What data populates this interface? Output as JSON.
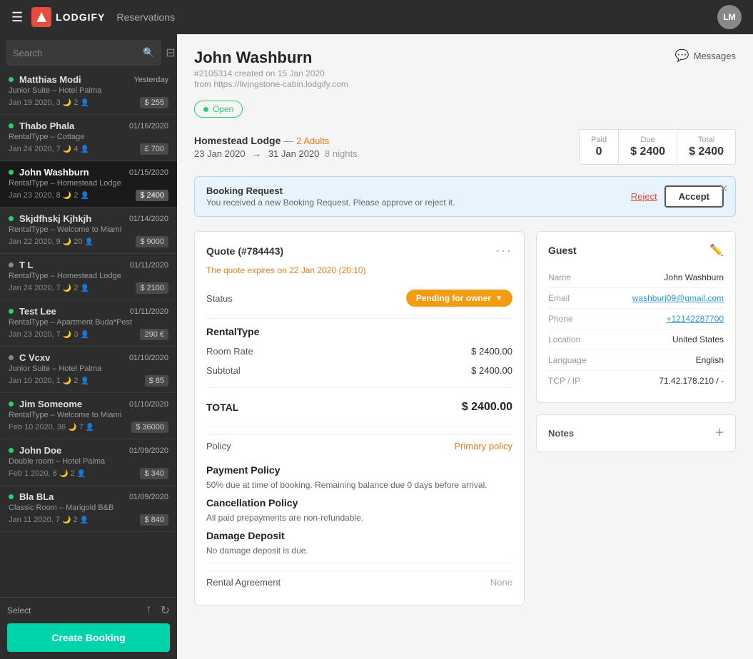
{
  "nav": {
    "brand": "LODGIFY",
    "page_title": "Reservations",
    "avatar_initials": "LM"
  },
  "sidebar": {
    "search_placeholder": "Search",
    "filter_icon": "⊟",
    "items": [
      {
        "name": "Matthias Modi",
        "date": "Yesterday",
        "subtitle": "Junior Suite – Hotel Palma",
        "dates_guests": "Jan 19 2020, 3 · 2",
        "amount": "$ 255",
        "active": false,
        "dot_color": "green"
      },
      {
        "name": "Thabo Phala",
        "date": "01/16/2020",
        "subtitle": "RentalType – Cottage",
        "dates_guests": "Jan 24 2020, 7 · 4",
        "amount": "£ 700",
        "active": false,
        "dot_color": "green"
      },
      {
        "name": "John Washburn",
        "date": "01/15/2020",
        "subtitle": "RentalType – Homestead Lodge",
        "dates_guests": "Jan 23 2020, 8 · 2",
        "amount": "$ 2400",
        "active": true,
        "dot_color": "green"
      },
      {
        "name": "Skjdfhskj Kjhkjh",
        "date": "01/14/2020",
        "subtitle": "RentalType – Welcome to Miami",
        "dates_guests": "Jan 22 2020, 9 · 20",
        "amount": "$ 9000",
        "active": false,
        "dot_color": "green"
      },
      {
        "name": "T L",
        "date": "01/11/2020",
        "subtitle": "RentalType – Homestead Lodge",
        "dates_guests": "Jan 24 2020, 7 · 2",
        "amount": "$ 2100",
        "active": false,
        "dot_color": "gray"
      },
      {
        "name": "Test Lee",
        "date": "01/11/2020",
        "subtitle": "RentalType – Apartment Buda*Pest",
        "dates_guests": "Jan 23 2020, 7 · 3",
        "amount": "290 €",
        "active": false,
        "dot_color": "green"
      },
      {
        "name": "C Vcxv",
        "date": "01/10/2020",
        "subtitle": "Junior Suite – Hotel Palma",
        "dates_guests": "Jan 10 2020, 1 · 2",
        "amount": "$ 85",
        "active": false,
        "dot_color": "gray"
      },
      {
        "name": "Jim Someome",
        "date": "01/10/2020",
        "subtitle": "RentalType – Welcome to Miami",
        "dates_guests": "Feb 10 2020, 36 · 7",
        "amount": "$ 36000",
        "active": false,
        "dot_color": "green"
      },
      {
        "name": "John Doe",
        "date": "01/09/2020",
        "subtitle": "Double room – Hotel Palma",
        "dates_guests": "Feb 1 2020, 8 · 2",
        "amount": "$ 340",
        "active": false,
        "dot_color": "green"
      },
      {
        "name": "Bla BLa",
        "date": "01/09/2020",
        "subtitle": "Classic Room – Marigold B&B",
        "dates_guests": "Jan 11 2020, 7 · 2",
        "amount": "$ 840",
        "active": false,
        "dot_color": "green"
      }
    ],
    "select_label": "Select",
    "create_booking_label": "Create Booking"
  },
  "booking": {
    "guest_name": "John Washburn",
    "booking_id": "#2105314 created on 15 Jan 2020",
    "booking_source": "from https://livingstone-cabin.lodgify.com",
    "status": "Open",
    "messages_label": "Messages",
    "property": "Homestead Lodge",
    "adults": "2 Adults",
    "check_in": "23 Jan 2020",
    "check_out": "31 Jan 2020",
    "nights": "8 nights",
    "paid_label": "Paid",
    "due_label": "Due",
    "total_label": "Total",
    "paid_value": "0",
    "due_value": "$ 2400",
    "total_value": "$ 2400",
    "banner": {
      "title": "Booking Request",
      "text": "You received a new Booking Request. Please approve or reject it.",
      "reject_label": "Reject",
      "accept_label": "Accept"
    },
    "quote": {
      "title": "Quote (#784443)",
      "expires": "The quote expires on 22 Jan 2020 (20:10)",
      "status_label": "Status",
      "status_value": "Pending for owner",
      "rental_type_label": "RentalType",
      "room_rate_label": "Room Rate",
      "room_rate_value": "$ 2400.00",
      "subtotal_label": "Subtotal",
      "subtotal_value": "$ 2400.00",
      "total_label": "TOTAL",
      "total_value": "$ 2400.00",
      "policy_label": "Policy",
      "policy_value": "Primary policy",
      "payment_policy_title": "Payment Policy",
      "payment_policy_text": "50% due at time of booking. Remaining balance due 0 days before arrival.",
      "cancellation_policy_title": "Cancellation Policy",
      "cancellation_policy_text": "All paid prepayments are non-refundable.",
      "damage_deposit_title": "Damage Deposit",
      "damage_deposit_text": "No damage deposit is due.",
      "rental_agreement_label": "Rental Agreement",
      "rental_agreement_value": "None"
    },
    "guest": {
      "title": "Guest",
      "name_label": "Name",
      "name_value": "John Washburn",
      "email_label": "Email",
      "email_value": "washburj09@gmail.com",
      "phone_label": "Phone",
      "phone_value": "+12142287700",
      "location_label": "Location",
      "location_value": "United States",
      "language_label": "Language",
      "language_value": "English",
      "tcp_label": "TCP / IP",
      "tcp_value": "71.42.178.210 / -"
    },
    "notes": {
      "title": "Notes"
    }
  }
}
